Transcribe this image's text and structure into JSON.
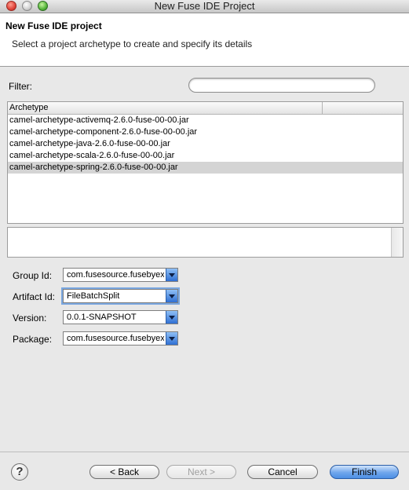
{
  "window": {
    "title": "New Fuse IDE Project"
  },
  "banner": {
    "title": "New Fuse IDE project",
    "description": "Select a project archetype to create and specify its details"
  },
  "filter": {
    "label": "Filter:",
    "value": ""
  },
  "table": {
    "column_header": "Archetype",
    "rows": [
      "camel-archetype-activemq-2.6.0-fuse-00-00.jar",
      "camel-archetype-component-2.6.0-fuse-00-00.jar",
      "camel-archetype-java-2.6.0-fuse-00-00.jar",
      "camel-archetype-scala-2.6.0-fuse-00-00.jar",
      "camel-archetype-spring-2.6.0-fuse-00-00.jar"
    ],
    "selected_row": "camel-archetype-spring-2.6.0-fuse-00-00.jar"
  },
  "description": {
    "text": ""
  },
  "fields": {
    "group_id": {
      "label": "Group Id:",
      "value": "com.fusesource.fusebyexample"
    },
    "artifact_id": {
      "label": "Artifact Id:",
      "value": "FileBatchSplit"
    },
    "version": {
      "label": "Version:",
      "value": "0.0.1-SNAPSHOT"
    },
    "package": {
      "label": "Package:",
      "value": "com.fusesource.fusebyexample"
    }
  },
  "buttons": {
    "help": "?",
    "back": "< Back",
    "next": "Next >",
    "cancel": "Cancel",
    "finish": "Finish"
  },
  "colors": {
    "accent": "#4d8fe4",
    "selection": "#d4d4d4"
  },
  "icons": [
    "close-icon",
    "minimize-icon",
    "zoom-icon",
    "help-icon",
    "dropdown-arrow-icon"
  ]
}
